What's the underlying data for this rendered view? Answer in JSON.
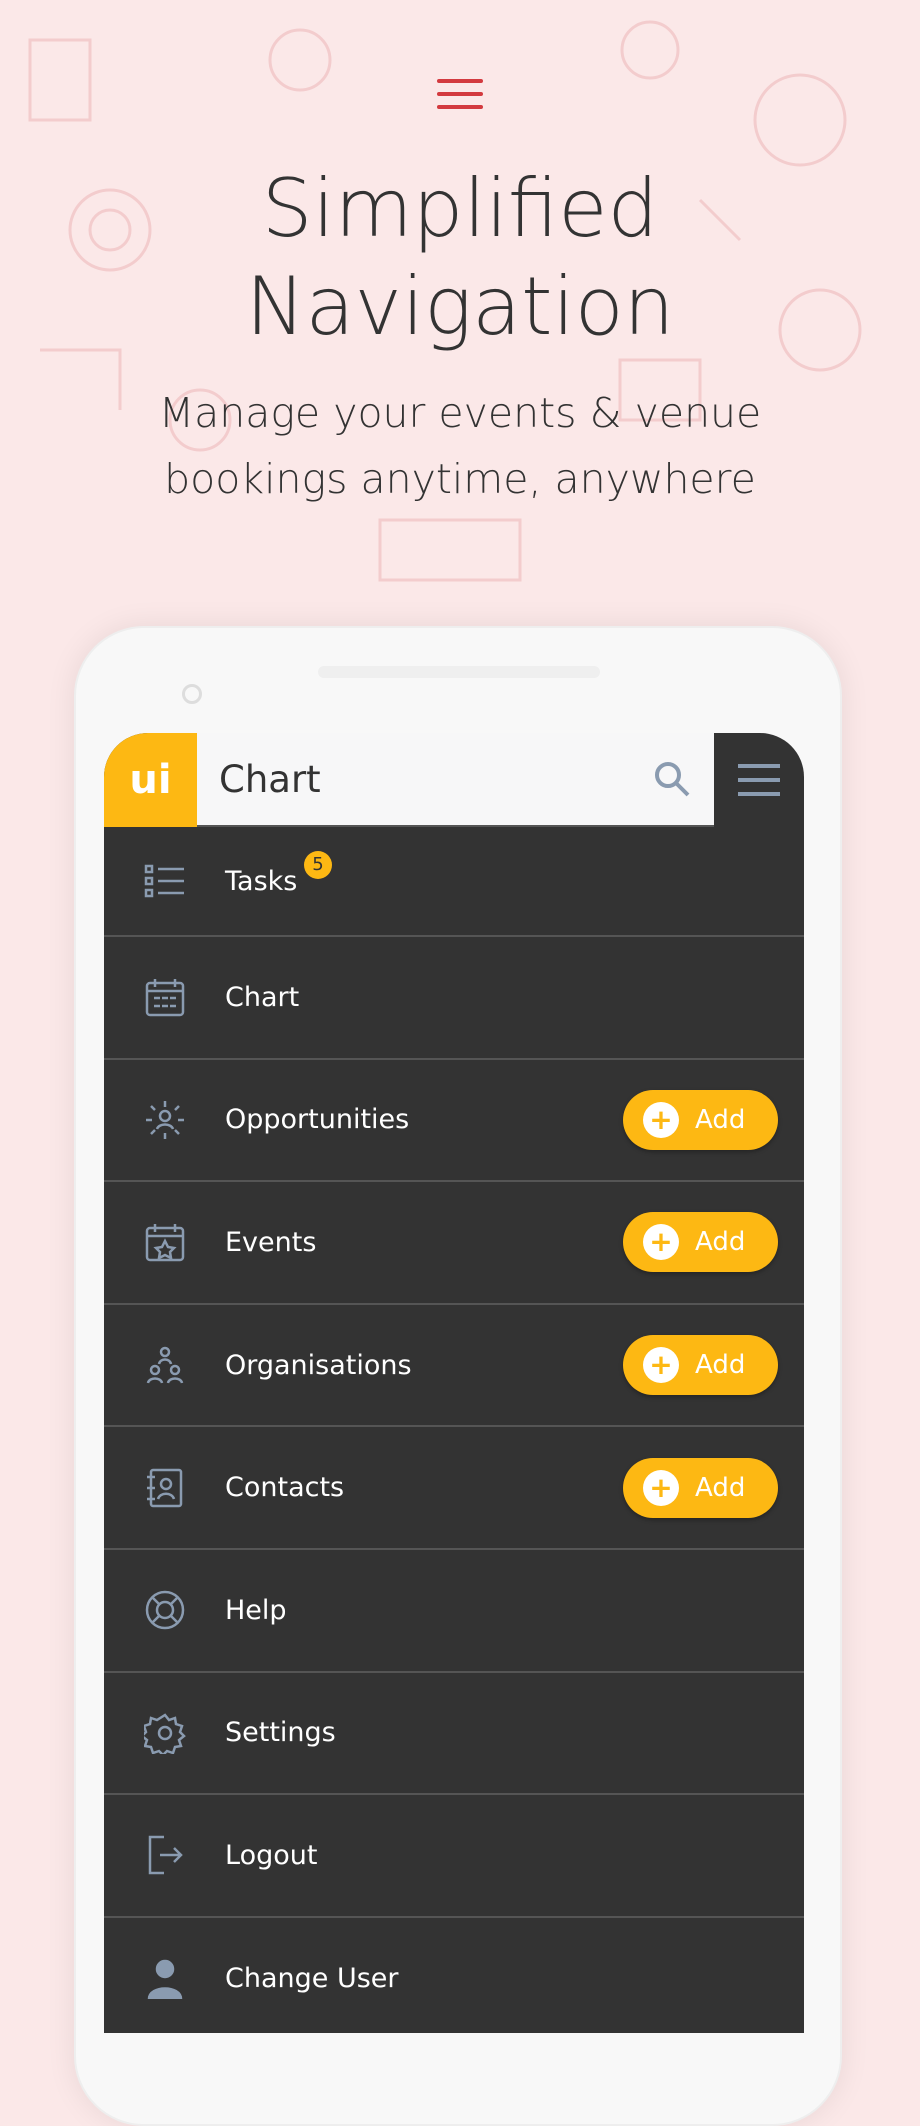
{
  "hero": {
    "title_line1": "Simplified",
    "title_line2": "Navigation",
    "subtitle_line1": "Manage your events & venue",
    "subtitle_line2": "bookings anytime, anywhere"
  },
  "app": {
    "logo": "ui",
    "search_title": "Chart",
    "accent": "#fdb813"
  },
  "menu": [
    {
      "label": "Tasks",
      "icon": "list-icon",
      "badge": "5"
    },
    {
      "label": "Chart",
      "icon": "calendar-grid-icon"
    },
    {
      "label": "Opportunities",
      "icon": "network-person-icon",
      "add": "Add"
    },
    {
      "label": "Events",
      "icon": "calendar-star-icon",
      "add": "Add"
    },
    {
      "label": "Organisations",
      "icon": "people-group-icon",
      "add": "Add"
    },
    {
      "label": "Contacts",
      "icon": "contact-book-icon",
      "add": "Add"
    },
    {
      "label": "Help",
      "icon": "lifebuoy-icon"
    },
    {
      "label": "Settings",
      "icon": "gear-icon"
    },
    {
      "label": "Logout",
      "icon": "logout-icon"
    },
    {
      "label": "Change User",
      "icon": "user-icon"
    }
  ]
}
